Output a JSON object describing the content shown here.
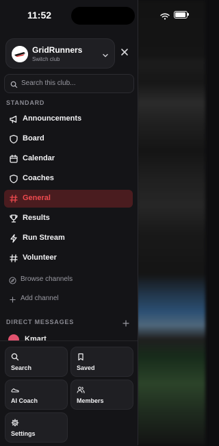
{
  "status_bar": {
    "time": "11:52"
  },
  "club": {
    "name": "GridRunners",
    "subtitle": "Switch club"
  },
  "search": {
    "placeholder": "Search this club..."
  },
  "sections": {
    "standard": "STANDARD",
    "direct_messages": "DIRECT MESSAGES"
  },
  "channels": [
    {
      "label": "Announcements",
      "icon": "megaphone-icon"
    },
    {
      "label": "Board",
      "icon": "shield-icon"
    },
    {
      "label": "Calendar",
      "icon": "calendar-icon"
    },
    {
      "label": "Coaches",
      "icon": "shield-icon"
    },
    {
      "label": "General",
      "icon": "hash-icon",
      "active": true
    },
    {
      "label": "Results",
      "icon": "trophy-icon"
    },
    {
      "label": "Run Stream",
      "icon": "lightning-icon"
    },
    {
      "label": "Volunteer",
      "icon": "hash-icon"
    }
  ],
  "channel_actions": {
    "browse": "Browse channels",
    "add": "Add channel"
  },
  "direct_messages": [
    {
      "name": "Kmart"
    }
  ],
  "bottom_tiles": [
    {
      "label": "Search",
      "icon": "search-icon"
    },
    {
      "label": "Saved",
      "icon": "bookmark-icon"
    },
    {
      "label": "AI Coach",
      "icon": "sneaker-icon"
    },
    {
      "label": "Members",
      "icon": "people-icon"
    },
    {
      "label": "Settings",
      "icon": "gear-icon"
    }
  ],
  "colors": {
    "accent": "#ef4a4f",
    "active_bg": "#4a1c1f",
    "panel_bg": "#141417"
  }
}
